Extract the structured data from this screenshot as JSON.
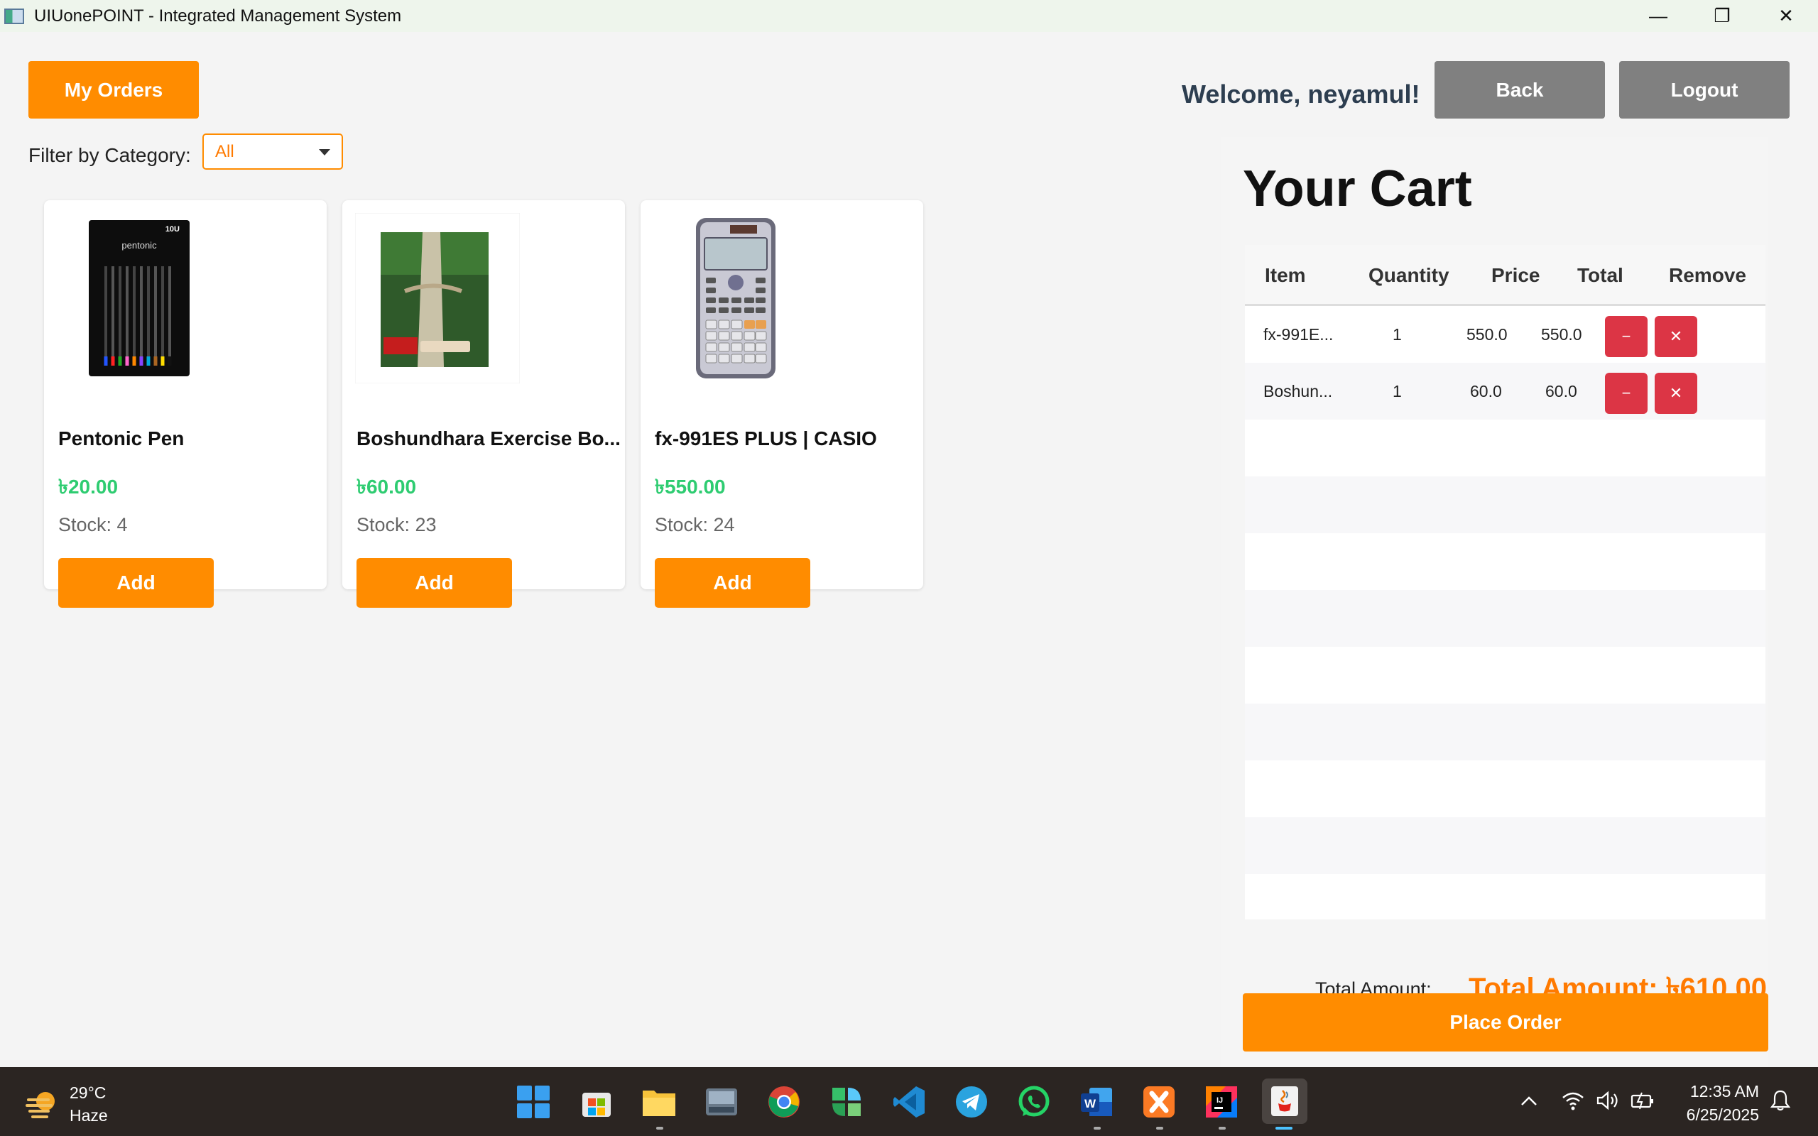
{
  "window": {
    "title": "UIUonePOINT - Integrated Management System",
    "minimize_glyph": "—",
    "restore_glyph": "❐",
    "close_glyph": "✕"
  },
  "header": {
    "my_orders_label": "My Orders",
    "welcome_text": "Welcome, neyamul!",
    "back_label": "Back",
    "logout_label": "Logout"
  },
  "filter": {
    "label": "Filter by Category:",
    "selected": "All"
  },
  "products": [
    {
      "name": "Pentonic Pen",
      "price": "৳20.00",
      "stock": "Stock: 4",
      "add_label": "Add",
      "image": "pentonic-pen-pack"
    },
    {
      "name": "Boshundhara Exercise Bo...",
      "price": "৳60.00",
      "stock": "Stock: 23",
      "add_label": "Add",
      "image": "exercise-book-cover"
    },
    {
      "name": "fx-991ES PLUS | CASIO",
      "price": "৳550.00",
      "stock": "Stock: 24",
      "add_label": "Add",
      "image": "casio-calculator"
    }
  ],
  "cart": {
    "title": "Your Cart",
    "columns": [
      "Item",
      "Quantity",
      "Price",
      "Total",
      "Remove"
    ],
    "rows": [
      {
        "item": "fx-991E...",
        "quantity": "1",
        "price": "550.0",
        "total": "550.0",
        "minus": "−",
        "remove": "✕"
      },
      {
        "item": "Boshun...",
        "quantity": "1",
        "price": "60.0",
        "total": "60.0",
        "minus": "−",
        "remove": "✕"
      }
    ],
    "total_label": "Total Amount:",
    "total_amount": "Total Amount: ৳610.00",
    "place_order_label": "Place Order"
  },
  "taskbar": {
    "weather_temp": "29°C",
    "weather_desc": "Haze",
    "time": "12:35 AM",
    "date": "6/25/2025",
    "apps": [
      "windows-start",
      "microsoft-store",
      "file-explorer",
      "keyboard-app",
      "chrome",
      "ms-apps",
      "vscode",
      "telegram",
      "whatsapp",
      "word",
      "xampp",
      "intellij",
      "java-app"
    ]
  },
  "colors": {
    "accent": "#ff8c00",
    "price_green": "#2ecc71",
    "danger": "#dc3545",
    "gray_button": "#808080",
    "taskbar": "#2b2522"
  }
}
